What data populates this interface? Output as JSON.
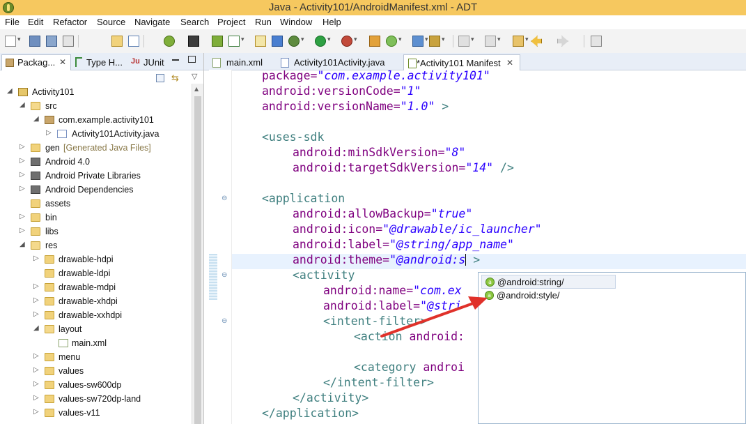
{
  "window": {
    "title": "Java - Activity101/AndroidManifest.xml - ADT"
  },
  "menu": [
    "File",
    "Edit",
    "Refactor",
    "Source",
    "Navigate",
    "Search",
    "Project",
    "Run",
    "Window",
    "Help"
  ],
  "left_tabs": {
    "package": "Packag...",
    "type": "Type H...",
    "junit": "JUnit",
    "junit_prefix": "Ju"
  },
  "tree": {
    "project": "Activity101",
    "src": "src",
    "package": "com.example.activity101",
    "java_file": "Activity101Activity.java",
    "gen": "gen",
    "gen_decor": "[Generated Java Files]",
    "android": "Android 4.0",
    "private_libs": "Android Private Libraries",
    "dependencies": "Android Dependencies",
    "assets": "assets",
    "bin": "bin",
    "libs": "libs",
    "res": "res",
    "dh": "drawable-hdpi",
    "dl": "drawable-ldpi",
    "dm": "drawable-mdpi",
    "dxh": "drawable-xhdpi",
    "dxxh": "drawable-xxhdpi",
    "layout": "layout",
    "mainxml": "main.xml",
    "menu": "menu",
    "values": "values",
    "v600": "values-sw600dp",
    "v720": "values-sw720dp-land",
    "v11": "values-v11"
  },
  "editor_tabs": {
    "main": "main.xml",
    "activity": "Activity101Activity.java",
    "manifest": "*Activity101 Manifest"
  },
  "code": {
    "l1a": "package=",
    "l1b": "\"com.example.activity101\"",
    "l2a": "android:versionCode=",
    "l2b": "\"1\"",
    "l3a": "android:versionName=",
    "l3b": "\"1.0\"",
    "l3c": " >",
    "l5": "<uses-sdk",
    "l6a": "android:minSdkVersion=",
    "l6b": "\"8\"",
    "l7a": "android:targetSdkVersion=",
    "l7b": "\"14\"",
    "l7c": " />",
    "l9": "<application",
    "l10a": "android:allowBackup=",
    "l10b": "\"true\"",
    "l11a": "android:icon=",
    "l11b": "\"@drawable/ic_launcher\"",
    "l12a": "android:label=",
    "l12b": "\"@string/app_name\"",
    "l13a": "android:theme=",
    "l13b": "\"@android:s",
    "l13c": " >",
    "l14": "<activity",
    "l15a": "android:name=",
    "l15b": "\"com.ex",
    "l16a": "android:label=",
    "l16b": "\"@stri",
    "l17": "<intent-filter>",
    "l18a": "<action ",
    "l18b": "android:",
    "l20a": "<category ",
    "l20b": "androi",
    "l21": "</intent-filter>",
    "l22": "</activity>",
    "l23": "</application>"
  },
  "autocomplete": [
    {
      "label": "@android:string/",
      "icon": "a"
    },
    {
      "label": "@android:style/",
      "icon": "a"
    }
  ],
  "colors": {
    "tag": "#3f7f7f",
    "attr": "#7f007f",
    "string": "#2a00ff",
    "titlebar": "#f6c85f",
    "arrow": "#e0312a"
  }
}
